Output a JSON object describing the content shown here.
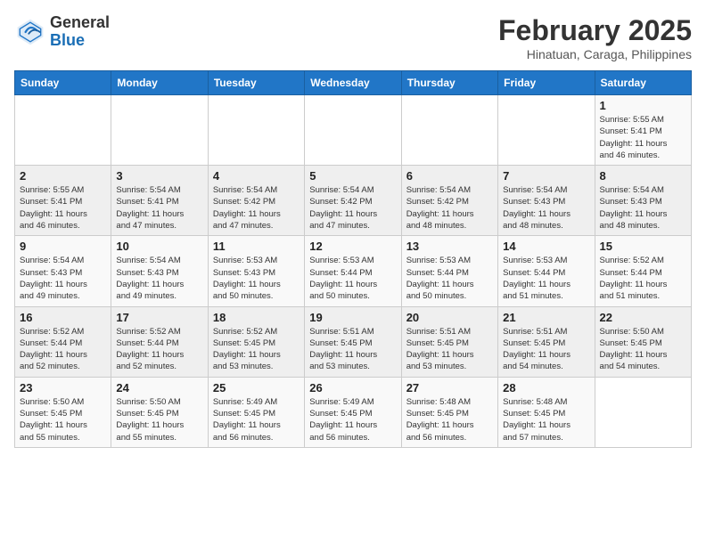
{
  "header": {
    "logo_general": "General",
    "logo_blue": "Blue",
    "title": "February 2025",
    "subtitle": "Hinatuan, Caraga, Philippines"
  },
  "days_of_week": [
    "Sunday",
    "Monday",
    "Tuesday",
    "Wednesday",
    "Thursday",
    "Friday",
    "Saturday"
  ],
  "weeks": [
    [
      {
        "day": "",
        "info": ""
      },
      {
        "day": "",
        "info": ""
      },
      {
        "day": "",
        "info": ""
      },
      {
        "day": "",
        "info": ""
      },
      {
        "day": "",
        "info": ""
      },
      {
        "day": "",
        "info": ""
      },
      {
        "day": "1",
        "info": "Sunrise: 5:55 AM\nSunset: 5:41 PM\nDaylight: 11 hours\nand 46 minutes."
      }
    ],
    [
      {
        "day": "2",
        "info": "Sunrise: 5:55 AM\nSunset: 5:41 PM\nDaylight: 11 hours\nand 46 minutes."
      },
      {
        "day": "3",
        "info": "Sunrise: 5:54 AM\nSunset: 5:41 PM\nDaylight: 11 hours\nand 47 minutes."
      },
      {
        "day": "4",
        "info": "Sunrise: 5:54 AM\nSunset: 5:42 PM\nDaylight: 11 hours\nand 47 minutes."
      },
      {
        "day": "5",
        "info": "Sunrise: 5:54 AM\nSunset: 5:42 PM\nDaylight: 11 hours\nand 47 minutes."
      },
      {
        "day": "6",
        "info": "Sunrise: 5:54 AM\nSunset: 5:42 PM\nDaylight: 11 hours\nand 48 minutes."
      },
      {
        "day": "7",
        "info": "Sunrise: 5:54 AM\nSunset: 5:43 PM\nDaylight: 11 hours\nand 48 minutes."
      },
      {
        "day": "8",
        "info": "Sunrise: 5:54 AM\nSunset: 5:43 PM\nDaylight: 11 hours\nand 48 minutes."
      }
    ],
    [
      {
        "day": "9",
        "info": "Sunrise: 5:54 AM\nSunset: 5:43 PM\nDaylight: 11 hours\nand 49 minutes."
      },
      {
        "day": "10",
        "info": "Sunrise: 5:54 AM\nSunset: 5:43 PM\nDaylight: 11 hours\nand 49 minutes."
      },
      {
        "day": "11",
        "info": "Sunrise: 5:53 AM\nSunset: 5:43 PM\nDaylight: 11 hours\nand 50 minutes."
      },
      {
        "day": "12",
        "info": "Sunrise: 5:53 AM\nSunset: 5:44 PM\nDaylight: 11 hours\nand 50 minutes."
      },
      {
        "day": "13",
        "info": "Sunrise: 5:53 AM\nSunset: 5:44 PM\nDaylight: 11 hours\nand 50 minutes."
      },
      {
        "day": "14",
        "info": "Sunrise: 5:53 AM\nSunset: 5:44 PM\nDaylight: 11 hours\nand 51 minutes."
      },
      {
        "day": "15",
        "info": "Sunrise: 5:52 AM\nSunset: 5:44 PM\nDaylight: 11 hours\nand 51 minutes."
      }
    ],
    [
      {
        "day": "16",
        "info": "Sunrise: 5:52 AM\nSunset: 5:44 PM\nDaylight: 11 hours\nand 52 minutes."
      },
      {
        "day": "17",
        "info": "Sunrise: 5:52 AM\nSunset: 5:44 PM\nDaylight: 11 hours\nand 52 minutes."
      },
      {
        "day": "18",
        "info": "Sunrise: 5:52 AM\nSunset: 5:45 PM\nDaylight: 11 hours\nand 53 minutes."
      },
      {
        "day": "19",
        "info": "Sunrise: 5:51 AM\nSunset: 5:45 PM\nDaylight: 11 hours\nand 53 minutes."
      },
      {
        "day": "20",
        "info": "Sunrise: 5:51 AM\nSunset: 5:45 PM\nDaylight: 11 hours\nand 53 minutes."
      },
      {
        "day": "21",
        "info": "Sunrise: 5:51 AM\nSunset: 5:45 PM\nDaylight: 11 hours\nand 54 minutes."
      },
      {
        "day": "22",
        "info": "Sunrise: 5:50 AM\nSunset: 5:45 PM\nDaylight: 11 hours\nand 54 minutes."
      }
    ],
    [
      {
        "day": "23",
        "info": "Sunrise: 5:50 AM\nSunset: 5:45 PM\nDaylight: 11 hours\nand 55 minutes."
      },
      {
        "day": "24",
        "info": "Sunrise: 5:50 AM\nSunset: 5:45 PM\nDaylight: 11 hours\nand 55 minutes."
      },
      {
        "day": "25",
        "info": "Sunrise: 5:49 AM\nSunset: 5:45 PM\nDaylight: 11 hours\nand 56 minutes."
      },
      {
        "day": "26",
        "info": "Sunrise: 5:49 AM\nSunset: 5:45 PM\nDaylight: 11 hours\nand 56 minutes."
      },
      {
        "day": "27",
        "info": "Sunrise: 5:48 AM\nSunset: 5:45 PM\nDaylight: 11 hours\nand 56 minutes."
      },
      {
        "day": "28",
        "info": "Sunrise: 5:48 AM\nSunset: 5:45 PM\nDaylight: 11 hours\nand 57 minutes."
      },
      {
        "day": "",
        "info": ""
      }
    ]
  ]
}
